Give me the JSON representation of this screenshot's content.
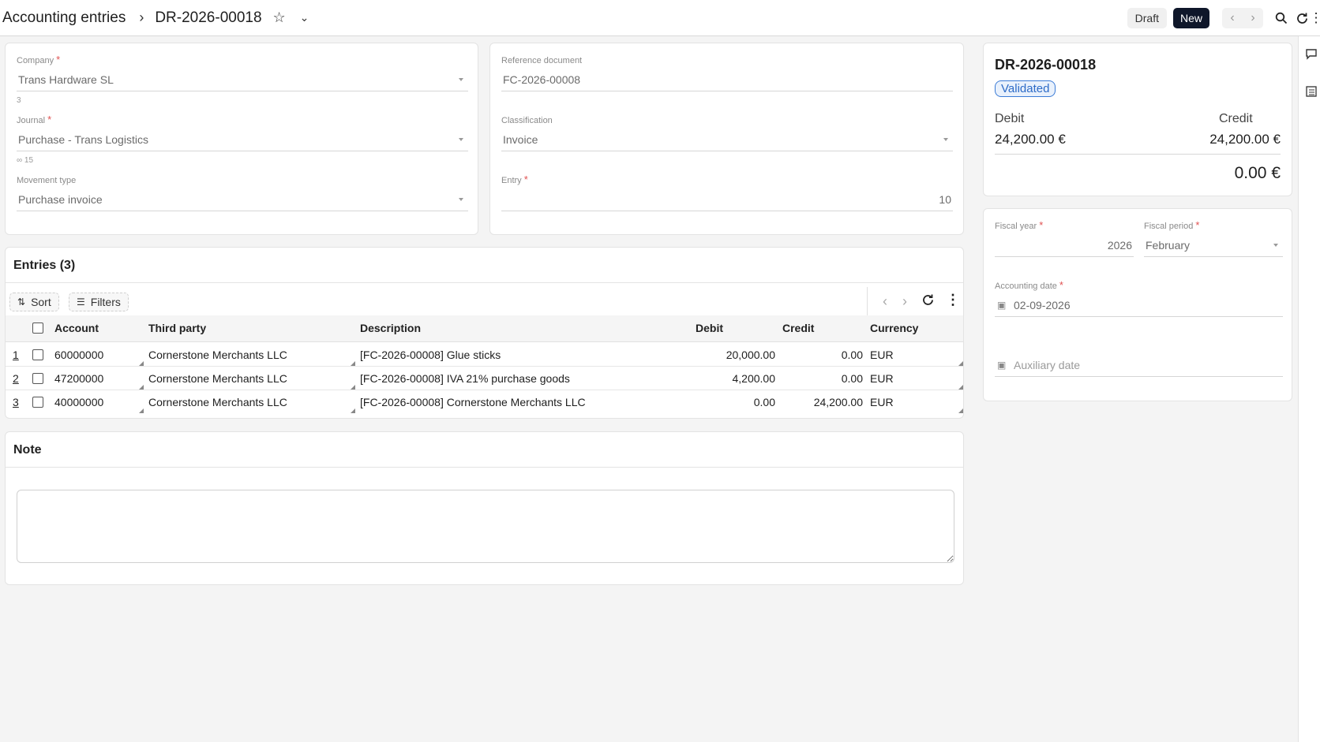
{
  "header": {
    "breadcrumb_root": "Accounting entries",
    "doc_id": "DR-2026-00018",
    "draft_label": "Draft",
    "new_label": "New"
  },
  "form": {
    "company": {
      "label": "Company",
      "value": "Trans Hardware SL",
      "hint": "3"
    },
    "journal": {
      "label": "Journal",
      "value": "Purchase - Trans Logistics",
      "hint": "15"
    },
    "movement_type": {
      "label": "Movement type",
      "value": "Purchase invoice"
    },
    "reference_document": {
      "label": "Reference document",
      "value": "FC-2026-00008"
    },
    "classification": {
      "label": "Classification",
      "value": "Invoice"
    },
    "entry": {
      "label": "Entry",
      "value": "10"
    }
  },
  "entries": {
    "title": "Entries (3)",
    "sort_label": "Sort",
    "filters_label": "Filters",
    "columns": [
      "Account",
      "Third party",
      "Description",
      "Debit",
      "Credit",
      "Currency"
    ],
    "rows": [
      {
        "n": "1",
        "account": "60000000",
        "third_party": "Cornerstone Merchants LLC",
        "description": "[FC-2026-00008] Glue sticks",
        "debit": "20,000.00",
        "credit": "0.00",
        "currency": "EUR"
      },
      {
        "n": "2",
        "account": "47200000",
        "third_party": "Cornerstone Merchants LLC",
        "description": "[FC-2026-00008] IVA 21% purchase goods",
        "debit": "4,200.00",
        "credit": "0.00",
        "currency": "EUR"
      },
      {
        "n": "3",
        "account": "40000000",
        "third_party": "Cornerstone Merchants LLC",
        "description": "[FC-2026-00008] Cornerstone Merchants LLC",
        "debit": "0.00",
        "credit": "24,200.00",
        "currency": "EUR"
      }
    ]
  },
  "note": {
    "title": "Note",
    "value": ""
  },
  "summary": {
    "doc_id": "DR-2026-00018",
    "status": "Validated",
    "debit_label": "Debit",
    "credit_label": "Credit",
    "debit_value": "24,200.00 €",
    "credit_value": "24,200.00 €",
    "balance": "0.00 €"
  },
  "fiscal": {
    "year": {
      "label": "Fiscal year",
      "value": "2026"
    },
    "period": {
      "label": "Fiscal period",
      "value": "February"
    },
    "accounting_date": {
      "label": "Accounting date",
      "value": "02-09-2026"
    },
    "auxiliary_date": {
      "placeholder": "Auxiliary date"
    }
  },
  "colors": {
    "accent": "#0f172a",
    "status_border": "#3b7bd6",
    "status_bg": "#e9f1fc",
    "required": "#e05252"
  }
}
